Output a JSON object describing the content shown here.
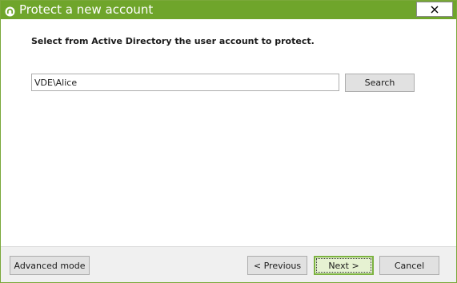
{
  "window": {
    "title": "Protect a new account",
    "accent_color": "#6fa52b"
  },
  "main": {
    "instruction": "Select from Active Directory the user account to protect.",
    "account_value": "VDE\\Alice",
    "search_label": "Search"
  },
  "footer": {
    "advanced_label": "Advanced mode",
    "previous_label": "< Previous",
    "next_label": "Next >",
    "cancel_label": "Cancel"
  },
  "icons": {
    "app": "app-logo-icon",
    "close": "close-icon"
  }
}
